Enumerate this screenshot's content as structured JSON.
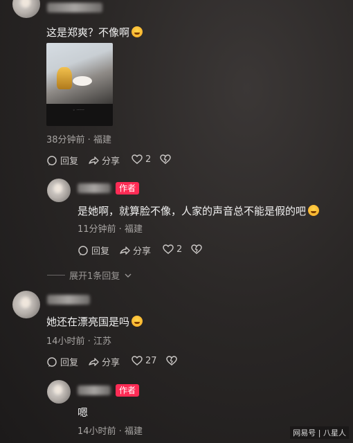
{
  "comments": [
    {
      "text": "这是郑爽？不像啊",
      "meta": "38分钟前 · 福建",
      "reply_label": "回复",
      "share_label": "分享",
      "likes": "2"
    },
    {
      "author_badge": "作者",
      "text": "是她啊，就算脸不像，人家的声音总不能是假的吧",
      "meta": "11分钟前 · 福建",
      "reply_label": "回复",
      "share_label": "分享",
      "likes": "2"
    },
    {
      "text": "她还在漂亮国是吗",
      "meta": "14小时前 · 江苏",
      "reply_label": "回复",
      "share_label": "分享",
      "likes": "27"
    },
    {
      "author_badge": "作者",
      "text": "嗯",
      "meta": "14小时前 · 福建"
    }
  ],
  "expand_replies": "展开1条回复",
  "watermark": "网易号 | 八星人",
  "icons": [
    "reply-icon",
    "share-icon",
    "heart-icon",
    "dislike-heart-icon",
    "chevron-down-icon"
  ],
  "colors": {
    "author_badge": "#fe2c55",
    "background": "#2a2726"
  }
}
